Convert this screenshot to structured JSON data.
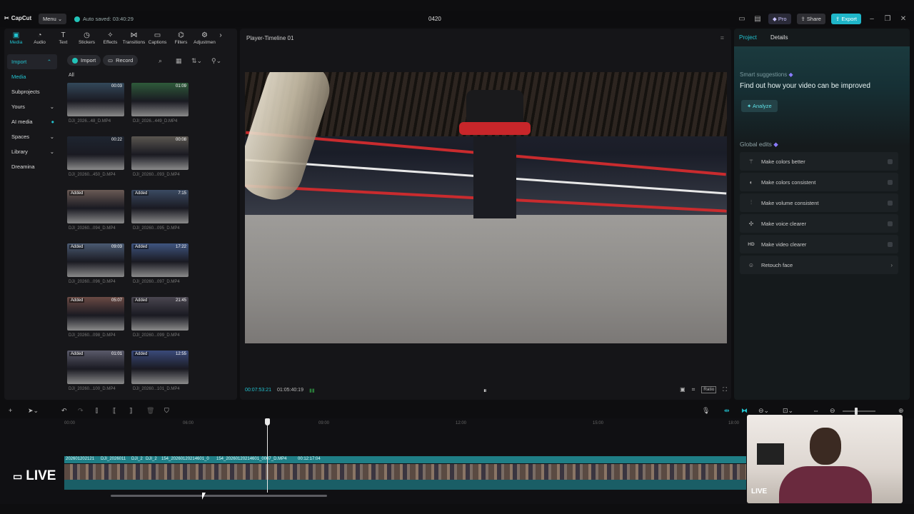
{
  "app": {
    "logo": "CapCut",
    "menu_label": "Menu",
    "autosave": "Auto saved: 03:40:29",
    "project_name": "0420"
  },
  "topbar": {
    "pro": "Pro",
    "share": "Share",
    "export": "Export"
  },
  "tools": [
    {
      "label": "Media",
      "icon": "media-icon"
    },
    {
      "label": "Audio",
      "icon": "audio-icon"
    },
    {
      "label": "Text",
      "icon": "text-icon"
    },
    {
      "label": "Stickers",
      "icon": "stickers-icon"
    },
    {
      "label": "Effects",
      "icon": "effects-icon"
    },
    {
      "label": "Transitions",
      "icon": "transitions-icon"
    },
    {
      "label": "Captions",
      "icon": "captions-icon"
    },
    {
      "label": "Filters",
      "icon": "filters-icon"
    },
    {
      "label": "Adjustmen",
      "icon": "adjustment-icon"
    }
  ],
  "sidebar": [
    {
      "label": "Import",
      "chevron": "⌃"
    },
    {
      "label": "Media",
      "chevron": ""
    },
    {
      "label": "Subprojects",
      "chevron": ""
    },
    {
      "label": "Yours",
      "chevron": "⌄"
    },
    {
      "label": "AI media",
      "chevron": ""
    },
    {
      "label": "Spaces",
      "chevron": "⌄"
    },
    {
      "label": "Library",
      "chevron": "⌄"
    },
    {
      "label": "Dreamina",
      "chevron": ""
    }
  ],
  "media": {
    "import_btn": "Import",
    "record_btn": "Record",
    "filter_all": "All",
    "items": [
      {
        "name": "DJI_2026...48_D.MP4",
        "duration": "00:03",
        "added": ""
      },
      {
        "name": "DJI_2026...449_D.MP4",
        "duration": "01:09",
        "added": ""
      },
      {
        "name": "DJI_20260...450_D.MP4",
        "duration": "00:22",
        "added": ""
      },
      {
        "name": "DJI_20260...093_D.MP4",
        "duration": "00:08",
        "added": ""
      },
      {
        "name": "DJI_20260...094_D.MP4",
        "duration": "",
        "added": "Added"
      },
      {
        "name": "DJI_20260...095_D.MP4",
        "duration": "7:15",
        "added": "Added"
      },
      {
        "name": "DJI_20260...096_D.MP4",
        "duration": "09:03",
        "added": "Added"
      },
      {
        "name": "DJI_20260...097_D.MP4",
        "duration": "17:22",
        "added": "Added"
      },
      {
        "name": "DJI_20260...098_D.MP4",
        "duration": "05:07",
        "added": "Added"
      },
      {
        "name": "DJI_20260...099_D.MP4",
        "duration": "21:45",
        "added": "Added"
      },
      {
        "name": "DJI_20260...100_D.MP4",
        "duration": "01:01",
        "added": "Added"
      },
      {
        "name": "DJI_20260...101_D.MP4",
        "duration": "12:55",
        "added": "Added"
      }
    ]
  },
  "player": {
    "title": "Player-Timeline 01",
    "current_time": "00:07:53:21",
    "total_time": "01:05:40:19",
    "ratio": "Ratio"
  },
  "right_panel": {
    "tabs": [
      "Project",
      "Details"
    ],
    "smart_label": "Smart suggestions",
    "smart_title": "Find out how your video can be improved",
    "analyze": "Analyze",
    "global_label": "Global edits",
    "edits": [
      {
        "label": "Make colors better",
        "icon": "wand-icon"
      },
      {
        "label": "Make colors consistent",
        "icon": "palette-icon"
      },
      {
        "label": "Make volume consistent",
        "icon": "volume-icon"
      },
      {
        "label": "Make voice clearer",
        "icon": "voice-icon"
      },
      {
        "label": "Make video clearer",
        "icon": "hd-icon"
      },
      {
        "label": "Retouch face",
        "icon": "face-icon"
      }
    ]
  },
  "timeline": {
    "ruler": [
      "00:00",
      "06:00",
      "09:00",
      "12:00",
      "15:00",
      "18:00"
    ],
    "clip_labels": [
      "202601202121",
      "DJI_2026011",
      "DJI_2",
      "DJI_2",
      "154_20260120214601_0",
      "154_20260120214601_0007_D.MP4",
      "00:12:17:04"
    ]
  },
  "overlay": {
    "live_big": "LIVE",
    "live_small": "LIVE"
  }
}
